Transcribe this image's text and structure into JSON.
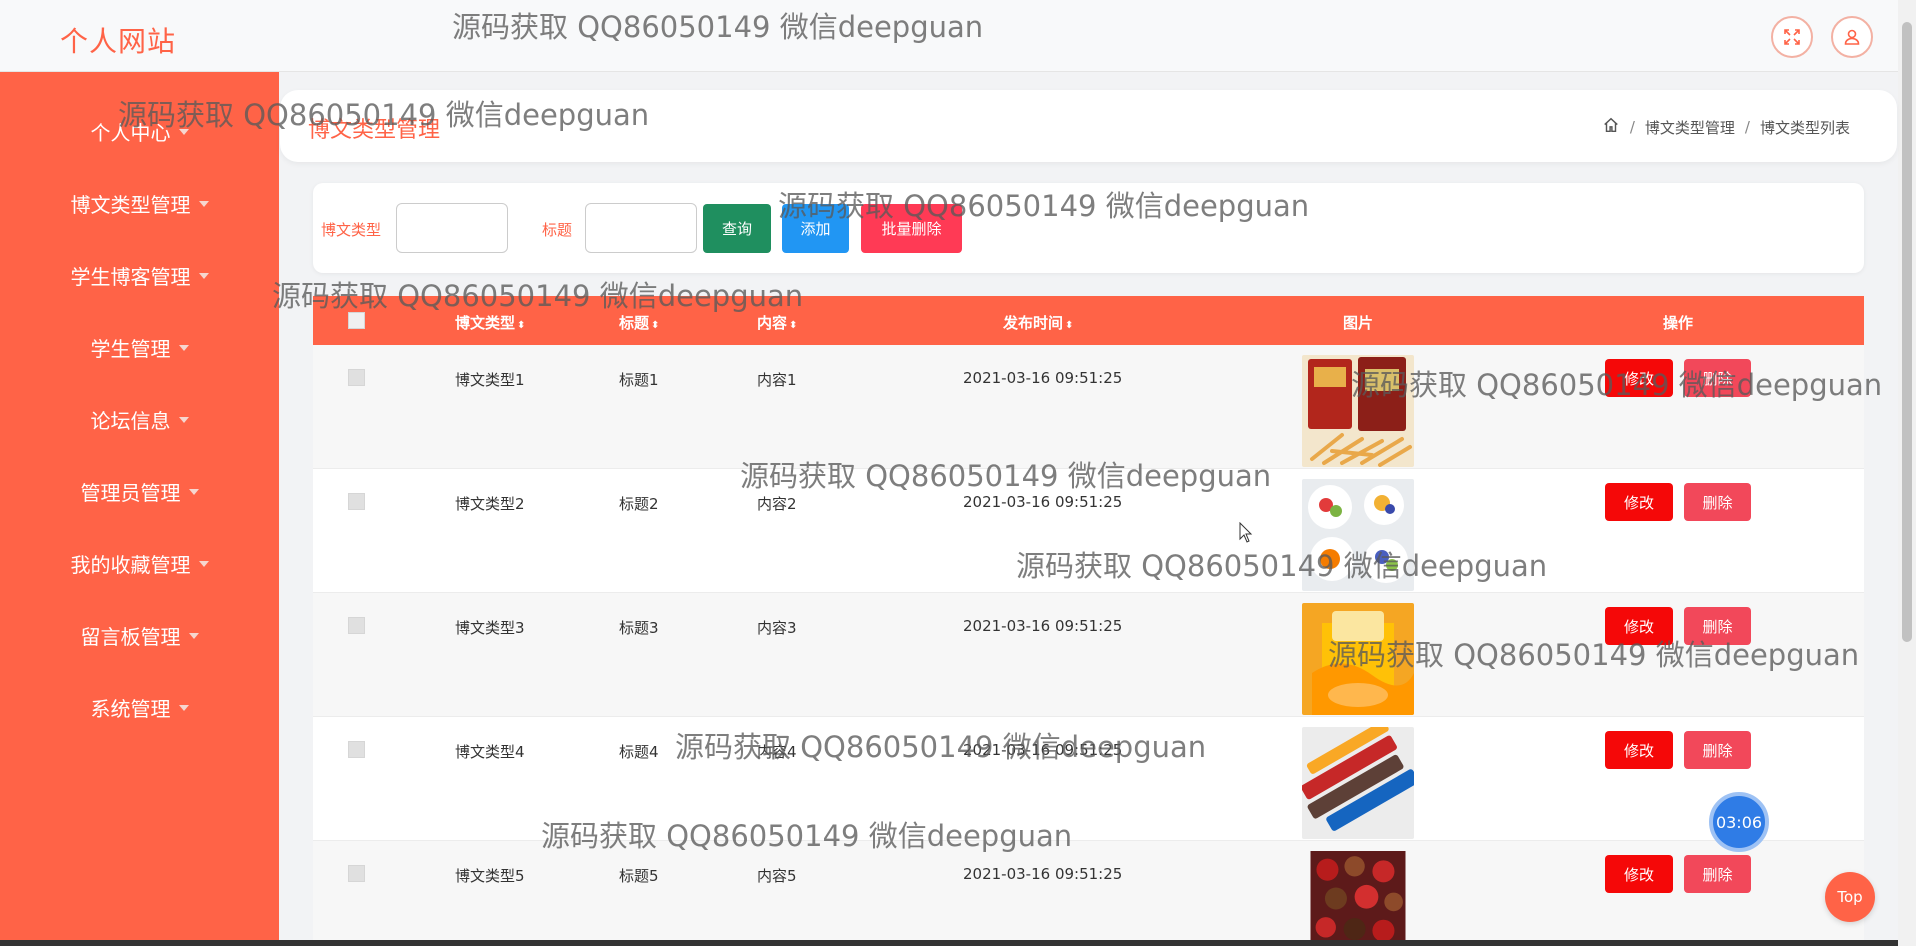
{
  "header": {
    "site_title": "个人网站",
    "icons": [
      "fullscreen-icon",
      "user-icon"
    ]
  },
  "sidebar": {
    "items": [
      {
        "label": "个人中心"
      },
      {
        "label": "博文类型管理"
      },
      {
        "label": "学生博客管理"
      },
      {
        "label": "学生管理"
      },
      {
        "label": "论坛信息"
      },
      {
        "label": "管理员管理"
      },
      {
        "label": "我的收藏管理"
      },
      {
        "label": "留言板管理"
      },
      {
        "label": "系统管理"
      }
    ]
  },
  "page": {
    "title": "博文类型管理",
    "breadcrumb": [
      "博文类型管理",
      "博文类型列表"
    ]
  },
  "search": {
    "type_label": "博文类型",
    "type_value": "",
    "title_label": "标题",
    "title_value": "",
    "query_label": "查询",
    "add_label": "添加",
    "batch_delete_label": "批量删除"
  },
  "table": {
    "columns": [
      "博文类型",
      "标题",
      "内容",
      "发布时间",
      "图片",
      "操作"
    ],
    "sort_glyph": "⬍",
    "rows": [
      {
        "type": "博文类型1",
        "title": "标题1",
        "content": "内容1",
        "time": "2021-03-16 09:51:25",
        "image": "snack-fries-image"
      },
      {
        "type": "博文类型2",
        "title": "标题2",
        "content": "内容2",
        "time": "2021-03-16 09:51:25",
        "image": "fruit-bowls-image"
      },
      {
        "type": "博文类型3",
        "title": "标题3",
        "content": "内容3",
        "time": "2021-03-16 09:51:25",
        "image": "chips-cup-image"
      },
      {
        "type": "博文类型4",
        "title": "标题4",
        "content": "内容4",
        "time": "2021-03-16 09:51:25",
        "image": "candy-bars-image"
      },
      {
        "type": "博文类型5",
        "title": "标题5",
        "content": "内容5",
        "time": "2021-03-16 09:51:25",
        "image": "chocolates-image"
      }
    ],
    "edit_label": "修改",
    "delete_label": "删除"
  },
  "timer": "03:06",
  "top_label": "Top",
  "watermark": "源码获取 QQ86050149 微信deepguan",
  "colors": {
    "accent": "#ff6347",
    "query": "#1f8f5f",
    "add": "#2196f3",
    "batch_delete": "#ff3a55",
    "edit": "#f50808",
    "delete": "#f2485a"
  }
}
